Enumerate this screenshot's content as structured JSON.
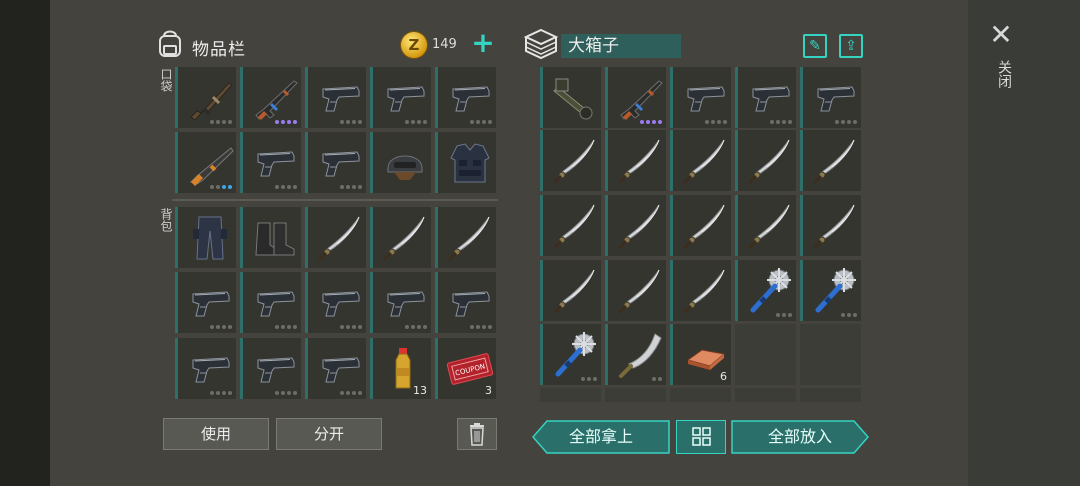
{
  "backpack": {
    "title": "物品栏",
    "coins": "149",
    "pocket_label": "口袋",
    "bag_label": "背包"
  },
  "container": {
    "title": "大箱子"
  },
  "close_label": "关闭",
  "buttons": {
    "use": "使用",
    "split": "分开",
    "take_all": "全部拿上",
    "put_all": "全部放入"
  },
  "counts": {
    "bottle": "13",
    "coupon": "3",
    "ingot": "6"
  },
  "colors": {
    "accent": "#35d3c2",
    "rarity_purple": "#9b7cf0",
    "rarity_blue": "#3aa6e8"
  }
}
